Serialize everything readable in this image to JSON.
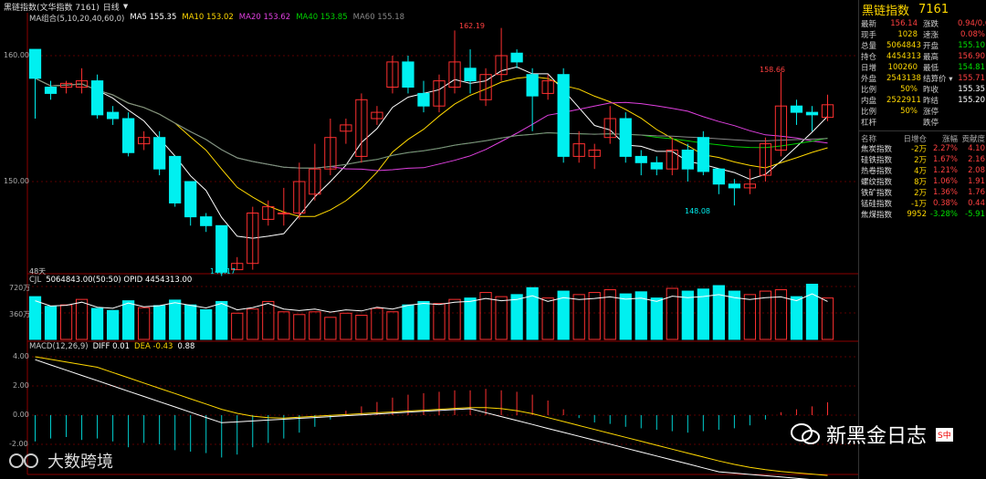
{
  "header": {
    "title": "黑链指数(文华指数 7161)",
    "period": "日线",
    "period_arrow": "▼"
  },
  "ma_line": {
    "label": "MA组合(5,10,20,40,60,0)",
    "ma5": "MA5 155.35",
    "ma10": "MA10 153.02",
    "ma20": "MA20 153.62",
    "ma40": "MA40 153.85",
    "ma60": "MA60 155.18"
  },
  "price_axis": {
    "p160": "160.00",
    "p150": "150.00"
  },
  "price_marks": {
    "high": "162.19",
    "low": "143.17",
    "recent_high": "158.66",
    "recent_low": "148.08",
    "days": "48天"
  },
  "volume": {
    "header_cjl": "CJL",
    "header_vals": "5064843.00(50:50)  OPID 4454313.00",
    "tick_top": "720万",
    "tick_mid": "360万"
  },
  "macd": {
    "label": "MACD(12,26,9)",
    "diff": "DIFF 0.01",
    "dea": "DEA -0.43",
    "macd": "0.88",
    "t4": "4.00",
    "t2": "2.00",
    "t0": "0.00",
    "tn2": "-2.00"
  },
  "side": {
    "name": "黑链指数",
    "code": "7161",
    "rows": [
      {
        "l1": "最新",
        "v1": "156.14",
        "c1": "red",
        "l2": "涨跌",
        "v2": "0.94/0.61%",
        "c2": "red"
      },
      {
        "l1": "现手",
        "v1": "1028",
        "c1": "yel",
        "l2": "速涨",
        "v2": "0.08%",
        "c2": "red"
      },
      {
        "l1": "总量",
        "v1": "5064843",
        "c1": "yel",
        "l2": "开盘",
        "v2": "155.10",
        "c2": "grn"
      },
      {
        "l1": "持仓",
        "v1": "4454313",
        "c1": "yel",
        "l2": "最高",
        "v2": "156.90",
        "c2": "red"
      },
      {
        "l1": "日增",
        "v1": "100260",
        "c1": "yel",
        "l2": "最低",
        "v2": "154.81",
        "c2": "grn"
      },
      {
        "l1": "外盘",
        "v1": "2543138",
        "c1": "yel",
        "l2": "结算价 ▾",
        "v2": "155.71",
        "c2": "red"
      },
      {
        "l1": "比例",
        "v1": "50%",
        "c1": "yel",
        "l2": "昨收",
        "v2": "155.35",
        "c2": "wh"
      },
      {
        "l1": "内盘",
        "v1": "2522911",
        "c1": "yel",
        "l2": "昨结",
        "v2": "155.20",
        "c2": "wh"
      },
      {
        "l1": "比例",
        "v1": "50%",
        "c1": "yel",
        "l2": "涨停",
        "v2": "",
        "c2": "wh"
      },
      {
        "l1": "杠杆",
        "v1": "",
        "c1": "yel",
        "l2": "跌停",
        "v2": "",
        "c2": "wh"
      }
    ],
    "table_head": {
      "h1": "名称",
      "h2": "日增仓",
      "h3": "涨幅",
      "h4": "贡献度"
    },
    "table": [
      {
        "name": "焦炭指数",
        "inc": "-2万",
        "chg": "2.27%",
        "ctb": "4.10",
        "cc": "red"
      },
      {
        "name": "硅铁指数",
        "inc": "2万",
        "chg": "1.67%",
        "ctb": "2.16",
        "cc": "red"
      },
      {
        "name": "热卷指数",
        "inc": "4万",
        "chg": "1.21%",
        "ctb": "2.08",
        "cc": "red"
      },
      {
        "name": "螺纹指数",
        "inc": "8万",
        "chg": "1.06%",
        "ctb": "1.91",
        "cc": "red"
      },
      {
        "name": "铁矿指数",
        "inc": "2万",
        "chg": "1.36%",
        "ctb": "1.76",
        "cc": "red"
      },
      {
        "name": "锰硅指数",
        "inc": "-1万",
        "chg": "0.38%",
        "ctb": "0.44",
        "cc": "red"
      },
      {
        "name": "焦煤指数",
        "inc": "9952",
        "chg": "-3.28%",
        "ctb": "-5.91",
        "cc": "grn"
      }
    ]
  },
  "watermark": {
    "brand": "新黑金日志",
    "logo2": "大数跨境",
    "ime": "S中"
  },
  "chart_data": {
    "type": "candlestick",
    "ylim": [
      140,
      165
    ],
    "candles": [
      [
        160.5,
        158.2,
        160.5,
        155.0
      ],
      [
        157.5,
        157.0,
        158.0,
        156.5
      ],
      [
        157.5,
        157.8,
        158.0,
        157.0
      ],
      [
        157.5,
        158.0,
        159.0,
        157.0
      ],
      [
        158.0,
        155.3,
        158.5,
        155.0
      ],
      [
        155.5,
        155.0,
        156.0,
        154.5
      ],
      [
        155.0,
        152.3,
        155.5,
        152.0
      ],
      [
        153.0,
        153.5,
        154.0,
        152.5
      ],
      [
        153.5,
        151.0,
        154.0,
        150.5
      ],
      [
        152.0,
        148.3,
        152.0,
        148.0
      ],
      [
        150.0,
        147.2,
        150.0,
        146.5
      ],
      [
        147.2,
        146.5,
        147.5,
        146.0
      ],
      [
        146.5,
        142.8,
        146.5,
        142.5
      ],
      [
        143.0,
        143.5,
        144.0,
        143.0
      ],
      [
        143.5,
        147.5,
        148.0,
        143.0
      ],
      [
        147.0,
        148.0,
        148.5,
        146.5
      ],
      [
        147.5,
        147.5,
        149.5,
        146.5
      ],
      [
        147.5,
        150.0,
        151.5,
        147.0
      ],
      [
        149.0,
        151.0,
        153.0,
        148.5
      ],
      [
        151.0,
        153.5,
        155.0,
        150.5
      ],
      [
        154.0,
        154.5,
        155.0,
        153.0
      ],
      [
        152.0,
        156.5,
        157.0,
        151.5
      ],
      [
        155.0,
        155.5,
        156.0,
        154.5
      ],
      [
        157.5,
        159.5,
        160.0,
        157.0
      ],
      [
        159.5,
        157.5,
        160.0,
        157.0
      ],
      [
        157.0,
        156.0,
        158.0,
        155.5
      ],
      [
        156.0,
        158.0,
        158.5,
        155.5
      ],
      [
        157.5,
        159.5,
        162.0,
        157.0
      ],
      [
        159.0,
        158.0,
        160.5,
        157.0
      ],
      [
        156.5,
        158.5,
        159.0,
        156.0
      ],
      [
        158.5,
        160.0,
        162.2,
        158.0
      ],
      [
        160.2,
        159.5,
        160.5,
        159.0
      ],
      [
        158.5,
        156.8,
        159.0,
        154.0
      ],
      [
        157.0,
        158.0,
        158.5,
        156.5
      ],
      [
        158.5,
        152.0,
        159.0,
        151.5
      ],
      [
        152.0,
        153.0,
        154.0,
        151.5
      ],
      [
        152.0,
        152.5,
        153.0,
        151.0
      ],
      [
        153.5,
        155.0,
        156.0,
        153.0
      ],
      [
        155.0,
        152.0,
        155.5,
        151.5
      ],
      [
        152.0,
        151.5,
        152.5,
        150.5
      ],
      [
        151.5,
        151.0,
        152.0,
        150.5
      ],
      [
        151.0,
        152.5,
        153.5,
        150.5
      ],
      [
        152.5,
        151.0,
        153.0,
        150.0
      ],
      [
        153.5,
        150.8,
        154.0,
        150.5
      ],
      [
        151.0,
        149.8,
        151.0,
        149.0
      ],
      [
        149.8,
        149.5,
        150.2,
        148.1
      ],
      [
        149.5,
        149.8,
        151.0,
        149.0
      ],
      [
        150.5,
        153.0,
        153.5,
        150.0
      ],
      [
        152.5,
        156.0,
        158.7,
        152.0
      ],
      [
        156.0,
        155.5,
        156.5,
        154.5
      ],
      [
        155.5,
        155.3,
        156.0,
        154.0
      ],
      [
        155.1,
        156.1,
        156.9,
        154.8
      ]
    ],
    "volume": [
      6.2,
      4.8,
      5.0,
      5.8,
      4.5,
      4.2,
      5.6,
      4.6,
      4.9,
      5.7,
      5.0,
      4.3,
      5.5,
      3.8,
      4.4,
      5.5,
      4.0,
      3.6,
      4.0,
      3.2,
      3.8,
      3.5,
      4.5,
      4.0,
      5.0,
      5.5,
      5.2,
      5.8,
      6.0,
      6.8,
      6.2,
      6.5,
      7.5,
      6.0,
      7.0,
      6.5,
      6.8,
      7.2,
      6.6,
      6.9,
      6.0,
      7.4,
      7.0,
      7.3,
      7.8,
      7.0,
      6.5,
      7.0,
      7.2,
      6.2,
      8.0,
      6.0
    ],
    "macd_hist": [
      -1.8,
      -1.6,
      -1.5,
      -1.7,
      -1.6,
      -1.8,
      -2.2,
      -1.9,
      -2.0,
      -2.4,
      -2.5,
      -2.6,
      -2.9,
      -2.7,
      -2.2,
      -1.9,
      -1.6,
      -1.2,
      -0.8,
      -0.3,
      0.3,
      0.6,
      0.9,
      1.2,
      1.4,
      1.5,
      1.6,
      1.7,
      1.7,
      1.8,
      1.7,
      1.6,
      1.4,
      1.0,
      0.4,
      -0.2,
      -0.5,
      -0.6,
      -0.8,
      -0.9,
      -1.0,
      -1.1,
      -1.2,
      -1.1,
      -1.0,
      -0.9,
      -0.7,
      -0.3,
      0.2,
      0.4,
      0.6,
      0.88
    ]
  }
}
